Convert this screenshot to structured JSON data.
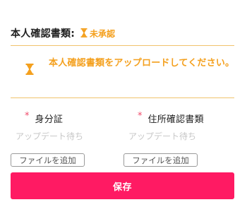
{
  "header": {
    "label": "本人確認書類:",
    "status_text": "未承認",
    "status_icon": "hourglass-icon"
  },
  "notice": {
    "icon": "hourglass-icon",
    "text": "本人確認書類をアップロードしてください。"
  },
  "documents": [
    {
      "required_mark": "*",
      "label": "身分証",
      "status": "アップデート待ち",
      "add_button": "ファイルを追加"
    },
    {
      "required_mark": "*",
      "label": "住所確認書類",
      "status": "アップデート待ち",
      "add_button": "ファイルを追加"
    }
  ],
  "save_button": "保存",
  "colors": {
    "accent_warning": "#f4a01e",
    "divider": "#f0c36d",
    "primary_button": "#ff1a63",
    "required": "#f04b6b"
  }
}
